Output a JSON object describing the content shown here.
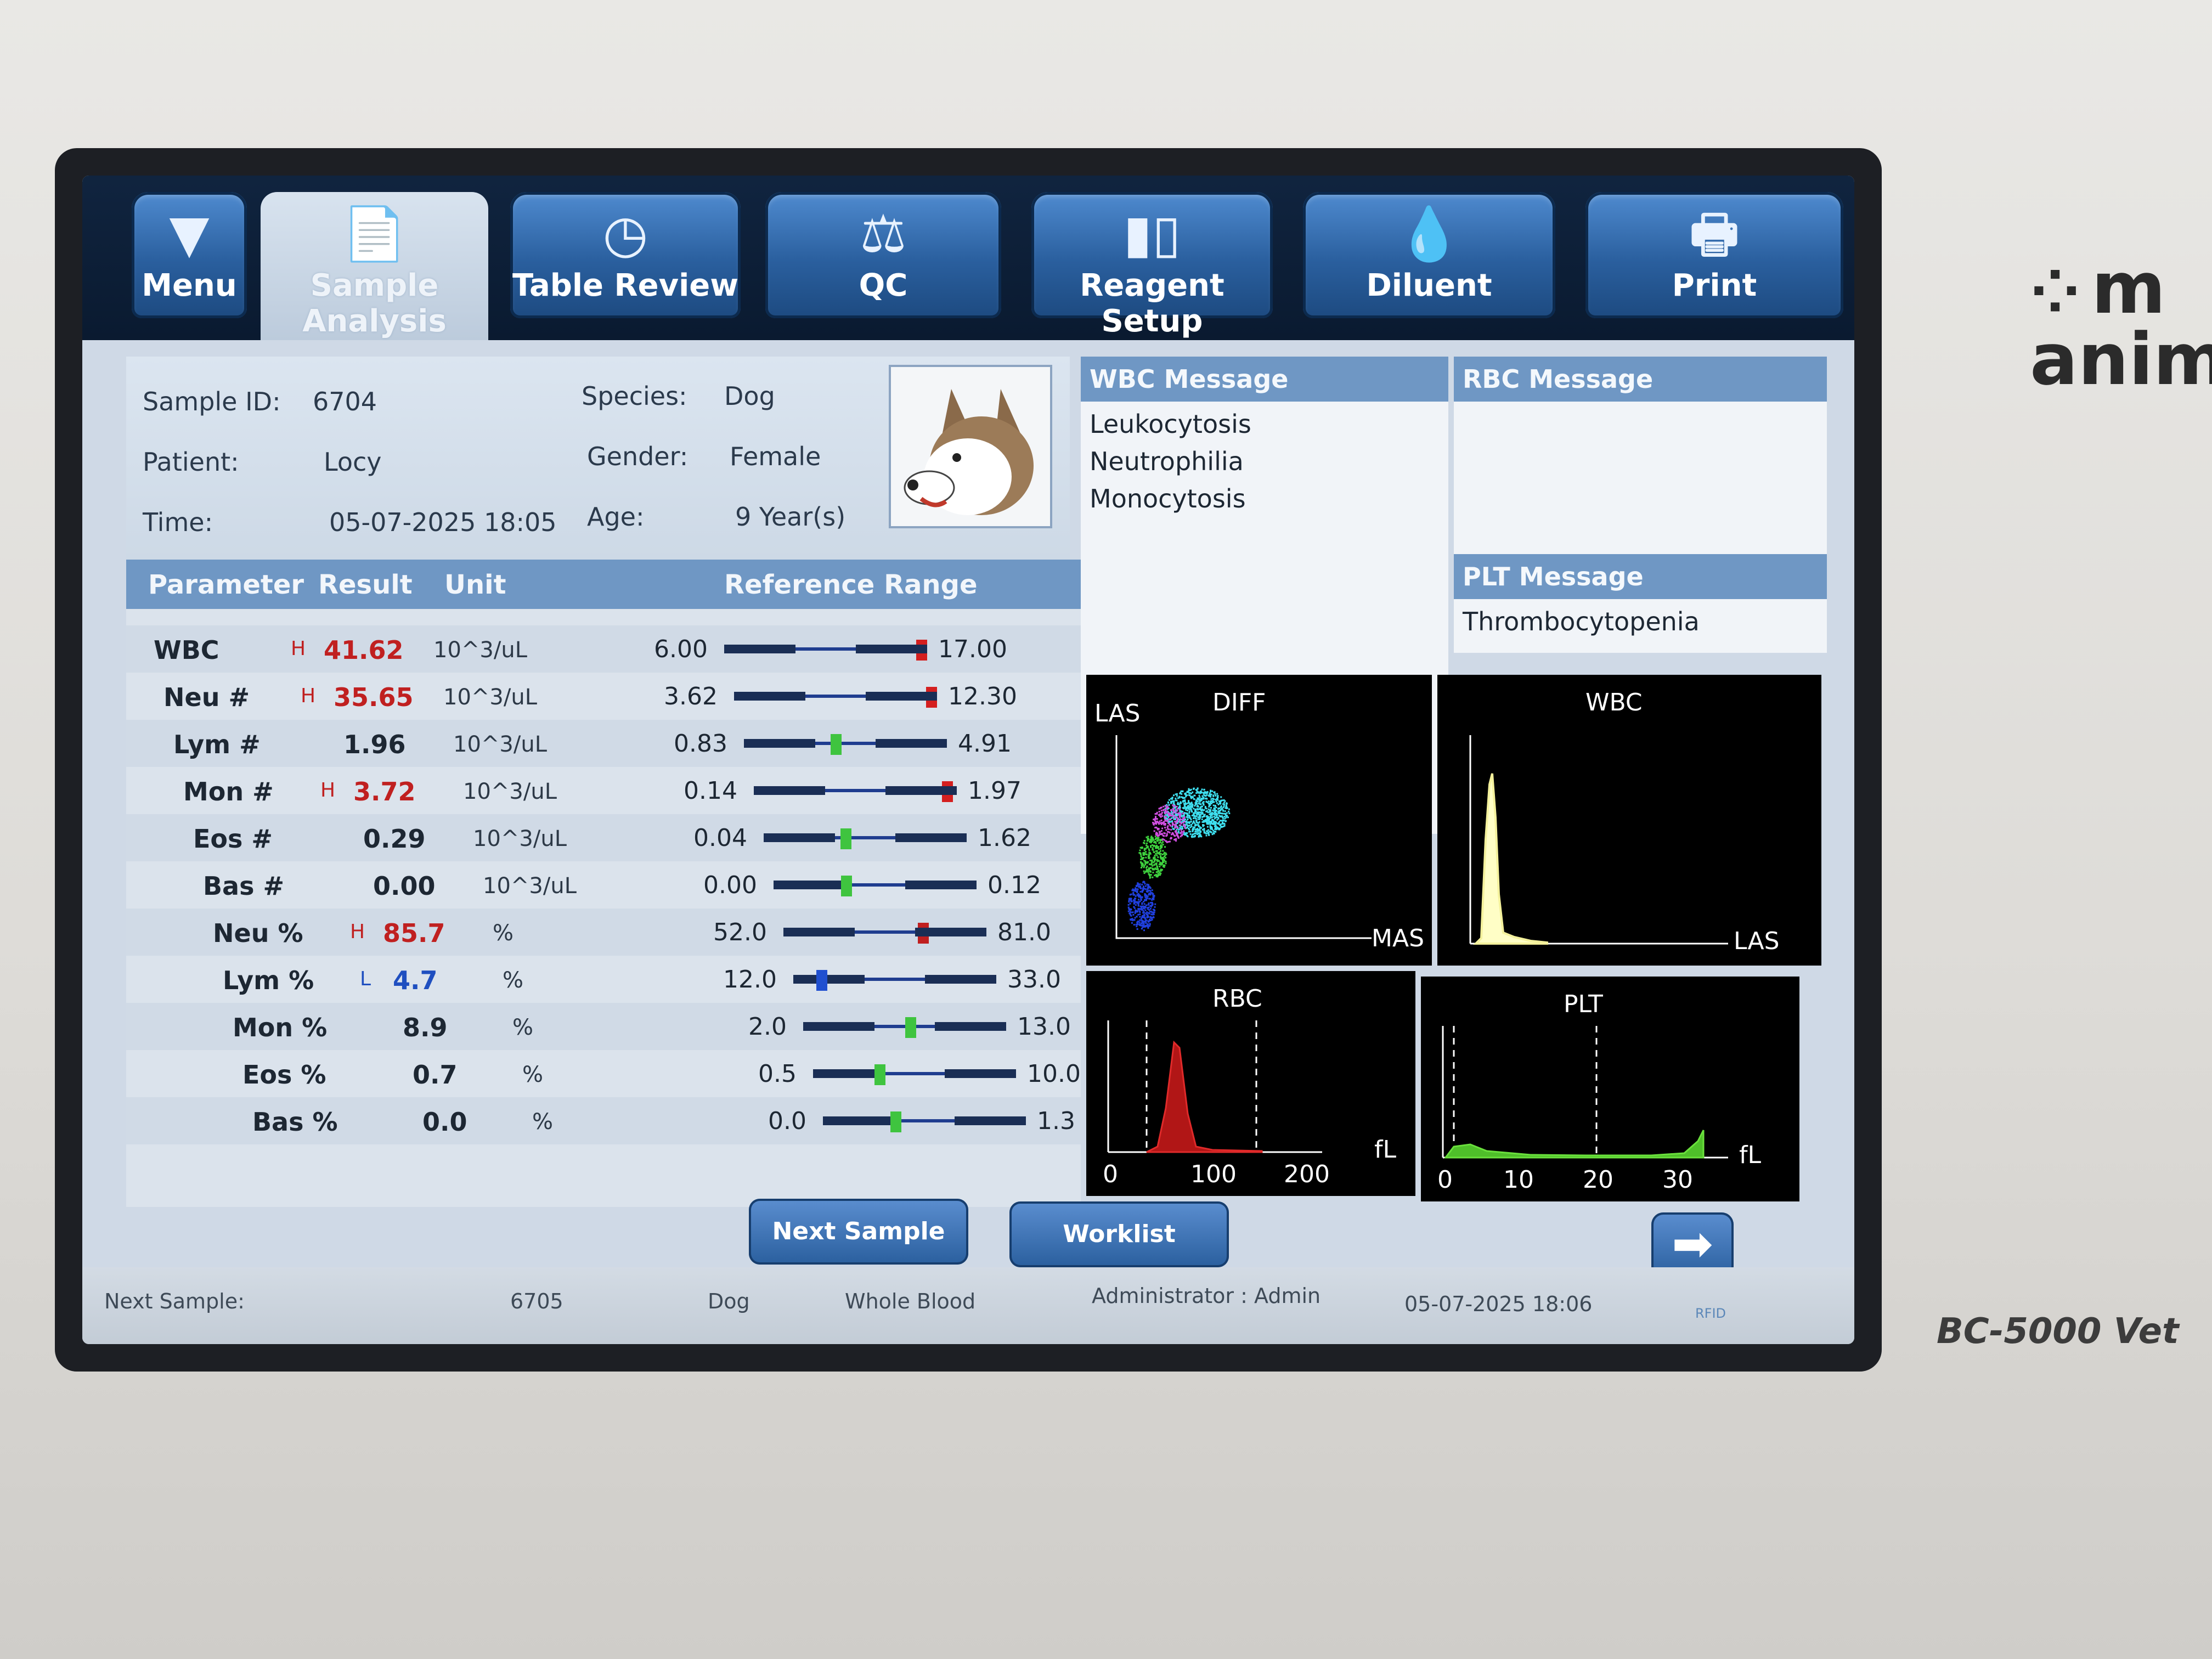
{
  "device": {
    "brand_text": "m anim",
    "model": "BC-5000 Vet"
  },
  "tabs": [
    {
      "label": "Menu",
      "icon": "triangle-down-icon"
    },
    {
      "label": "Sample Analysis",
      "icon": "document-chart-icon"
    },
    {
      "label": "Table Review",
      "icon": "table-clock-icon"
    },
    {
      "label": "QC",
      "icon": "scale-icon"
    },
    {
      "label": "Reagent Setup",
      "icon": "bottles-icon"
    },
    {
      "label": "Diluent",
      "icon": "drop-plus-icon"
    },
    {
      "label": "Print",
      "icon": "printer-icon"
    }
  ],
  "info": {
    "sample_id_label": "Sample ID:",
    "sample_id": "6704",
    "patient_label": "Patient:",
    "patient": "Locy",
    "time_label": "Time:",
    "time": "05-07-2025 18:05",
    "species_label": "Species:",
    "species": "Dog",
    "gender_label": "Gender:",
    "gender": "Female",
    "age_label": "Age:",
    "age": "9 Year(s)"
  },
  "table": {
    "headers": {
      "parameter": "Parameter",
      "result": "Result",
      "unit": "Unit",
      "range": "Reference Range"
    },
    "rows": [
      {
        "name": "WBC",
        "flag": "H",
        "result": "41.62",
        "unit": "10^3/uL",
        "low": "6.00",
        "high": "17.00",
        "pos": 1.0,
        "color": "#d41f1f"
      },
      {
        "name": "Neu #",
        "flag": "H",
        "result": "35.65",
        "unit": "10^3/uL",
        "low": "3.62",
        "high": "12.30",
        "pos": 1.0,
        "color": "#d41f1f"
      },
      {
        "name": "Lym #",
        "flag": "",
        "result": "1.96",
        "unit": "10^3/uL",
        "low": "0.83",
        "high": "4.91",
        "pos": 0.45,
        "color": "#3fc43f"
      },
      {
        "name": "Mon #",
        "flag": "H",
        "result": "3.72",
        "unit": "10^3/uL",
        "low": "0.14",
        "high": "1.97",
        "pos": 0.98,
        "color": "#d41f1f"
      },
      {
        "name": "Eos #",
        "flag": "",
        "result": "0.29",
        "unit": "10^3/uL",
        "low": "0.04",
        "high": "1.62",
        "pos": 0.4,
        "color": "#3fc43f"
      },
      {
        "name": "Bas #",
        "flag": "",
        "result": "0.00",
        "unit": "10^3/uL",
        "low": "0.00",
        "high": "0.12",
        "pos": 0.35,
        "color": "#3fc43f"
      },
      {
        "name": "Neu %",
        "flag": "H",
        "result": "85.7",
        "unit": "%",
        "low": "52.0",
        "high": "81.0",
        "pos": 0.7,
        "color": "#c01f1f"
      },
      {
        "name": "Lym %",
        "flag": "L",
        "result": "4.7",
        "unit": "%",
        "low": "12.0",
        "high": "33.0",
        "pos": 0.12,
        "color": "#1f4fd0"
      },
      {
        "name": "Mon %",
        "flag": "",
        "result": "8.9",
        "unit": "%",
        "low": "2.0",
        "high": "13.0",
        "pos": 0.53,
        "color": "#3fc43f"
      },
      {
        "name": "Eos %",
        "flag": "",
        "result": "0.7",
        "unit": "%",
        "low": "0.5",
        "high": "10.0",
        "pos": 0.32,
        "color": "#3fc43f"
      },
      {
        "name": "Bas %",
        "flag": "",
        "result": "0.0",
        "unit": "%",
        "low": "0.0",
        "high": "1.3",
        "pos": 0.35,
        "color": "#3fc43f"
      }
    ]
  },
  "messages": {
    "wbc_title": "WBC Message",
    "wbc_items": [
      "Leukocytosis",
      "Neutrophilia",
      "Monocytosis"
    ],
    "rbc_title": "RBC Message",
    "plt_title": "PLT Message",
    "plt_items": [
      "Thrombocytopenia"
    ]
  },
  "graphs": {
    "diff": {
      "title": "DIFF",
      "y_label": "LAS",
      "x_label": "MAS"
    },
    "wbc": {
      "title": "WBC",
      "x_label": "LAS"
    },
    "rbc": {
      "title": "RBC",
      "unit": "fL",
      "ticks": [
        "0",
        "100",
        "200"
      ]
    },
    "plt": {
      "title": "PLT",
      "unit": "fL",
      "ticks": [
        "0",
        "10",
        "20",
        "30"
      ]
    }
  },
  "buttons": {
    "next_sample": "Next Sample",
    "worklist": "Worklist",
    "arrow": "➡"
  },
  "status": {
    "next_sample_label": "Next Sample:",
    "next_sample_id": "6705",
    "species": "Dog",
    "mode": "Whole Blood",
    "user": "Administrator : Admin",
    "datetime": "05-07-2025 18:06",
    "rfid": "RFID"
  },
  "colors": {
    "accent": "#2a5f9e",
    "high": "#c02020",
    "low": "#1f4fc0",
    "normal": "#3fc43f"
  }
}
